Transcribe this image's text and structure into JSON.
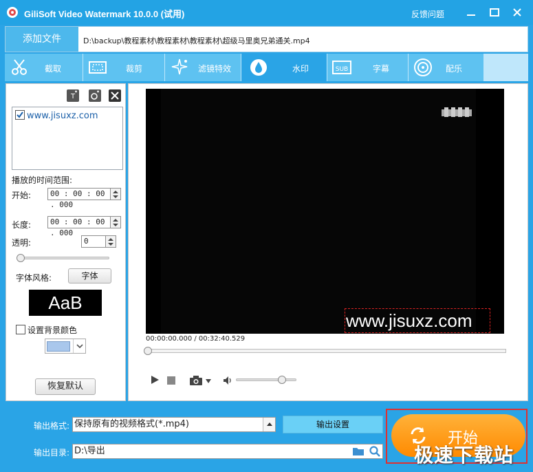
{
  "window": {
    "title": "GiliSoft Video Watermark 10.0.0 (试用)",
    "feedback": "反馈问题",
    "icons": [
      "minimize-icon",
      "maximize-icon",
      "close-icon"
    ]
  },
  "file": {
    "add_button": "添加文件",
    "path": "D:\\backup\\教程素材\\教程素材\\教程素材\\超级马里奥兄弟通关.mp4"
  },
  "tabs": [
    {
      "label": "截取",
      "icon": "scissors-icon",
      "active": false
    },
    {
      "label": "裁剪",
      "icon": "crop-icon",
      "active": false
    },
    {
      "label": "滤镜特效",
      "icon": "sparkle-icon",
      "active": false
    },
    {
      "label": "水印",
      "icon": "drop-icon",
      "active": true
    },
    {
      "label": "字幕",
      "icon": "subtitle-icon",
      "active": false
    },
    {
      "label": "配乐",
      "icon": "music-icon",
      "active": false
    }
  ],
  "watermark_panel": {
    "items": [
      "www.jisuxz.com"
    ],
    "time_range_label": "播放的时间范围:",
    "start_label": "开始:",
    "start_value": "00 : 00 : 00 . 000",
    "length_label": "长度:",
    "length_value": "00 : 00 : 00 . 000",
    "opacity_label": "透明:",
    "opacity_value": "0",
    "font_style_label": "字体风格:",
    "font_button": "字体",
    "font_preview": "AaB",
    "bg_color_label": "设置背景颜色",
    "bg_color": "#a9c7ec",
    "reset_button": "恢复默认"
  },
  "player": {
    "watermark_text": "www.jisuxz.com",
    "timecode": "00:00:00.000 / 00:32:40.529"
  },
  "output": {
    "format_label": "输出格式:",
    "format_value": "保持原有的视频格式(*.mp4)",
    "settings_button": "输出设置",
    "dir_label": "输出目录:",
    "dir_value": "D:\\导出",
    "start_button": "开始",
    "brand_watermark": "极速下载站"
  },
  "colors": {
    "accent": "#2aa4e6",
    "start": "#ff9a1a"
  }
}
